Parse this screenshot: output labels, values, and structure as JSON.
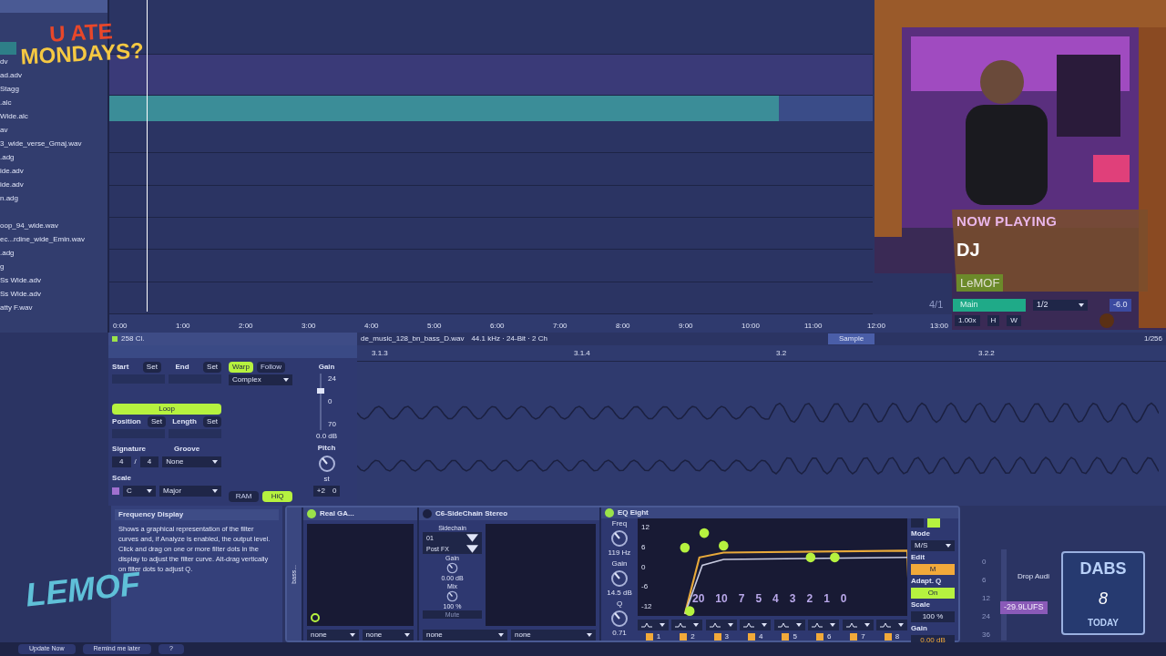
{
  "logo": {
    "line1": "U ATE",
    "line2": "MONDAYS?"
  },
  "browser": {
    "files": [
      "dv",
      "ad.adv",
      "Stagg",
      ".alc",
      "Wide.alc",
      "av",
      "3_wide_verse_Gmaj.wav",
      ".adg",
      "ide.adv",
      "ide.adv",
      "n.adg",
      "oop_94_wide.wav",
      "ec...rdine_wide_Emin.wav",
      ".adg",
      "g",
      "Ss Wide.adv",
      "Ss Wide.adv",
      "atty F.wav"
    ]
  },
  "arrangement": {
    "ruler": [
      "0:00",
      "1:00",
      "2:00",
      "3:00",
      "4:00",
      "5:00",
      "6:00",
      "7:00",
      "8:00",
      "9:00",
      "10:00",
      "11:00",
      "12:00",
      "13:00"
    ],
    "meter": "4/1"
  },
  "stream": {
    "heading": "NOW PLAYING",
    "dj": "DJ",
    "artist": "LeMOF",
    "main_clip": "Main",
    "quantize": "1/2",
    "volume": "-6.0",
    "tempo_scale": "1.00x",
    "buttons": [
      "H",
      "W"
    ]
  },
  "clip": {
    "name": "258 Cl.",
    "start": "Start",
    "end": "End",
    "set_buttons": [
      "Set",
      "Set",
      "Set",
      "Set"
    ],
    "gain_fader": {
      "level": 0.7
    },
    "loop": {
      "label": "Loop",
      "on": true
    },
    "position": "Position",
    "length": "Length",
    "signature": "Signature",
    "sig_num": "4",
    "sig_sep": "/",
    "sig_den": "4",
    "groove": "Groove",
    "groove_value": "None",
    "scale": "Scale",
    "scale_root": "C",
    "scale_mode": "Major",
    "warp": {
      "label": "Warp",
      "on": true
    },
    "follow": {
      "label": "Follow",
      "on": false
    },
    "warp_mode": "Complex",
    "ram": {
      "label": "RAM",
      "on": false
    },
    "hiq": {
      "label": "HiQ",
      "on": true
    },
    "gain": "Gain",
    "gain_ticks": [
      "24",
      "0",
      "70"
    ],
    "gain_value": "0.0 dB",
    "pitch": "Pitch",
    "pitch_unit": "st",
    "pitch_values": [
      "+2",
      "0"
    ]
  },
  "sample": {
    "file": "de_music_128_bn_bass_D.wav",
    "format": "44.1 kHz · 24-Bit · 2 Ch",
    "tab": "Sample",
    "zoom": "1/256",
    "markers": [
      "3.1.3",
      "3.1.4",
      "3.2",
      "3.2.2"
    ]
  },
  "info": {
    "title": "Frequency Display",
    "body": "Shows a graphical representation of the filter curves and, if Analyze is enabled, the output level. Click and drag on one or more filter dots in the display to adjust the filter curve. Alt-drag vertically on filter dots to adjust Q."
  },
  "rack": {
    "label": "bass..."
  },
  "devices": [
    {
      "kind": "generic",
      "name": "Real GA...",
      "on": true,
      "routes": [
        "none",
        "none"
      ]
    },
    {
      "kind": "sidechain",
      "name": "C6-SideChain Stereo",
      "on": false,
      "sidechain": "Sidechain",
      "source": "01",
      "tap": "Post FX",
      "gain": "Gain",
      "gain_value": "0.00 dB",
      "mix": "Mix",
      "mix_value": "100 %",
      "mute": "Mute",
      "routes": [
        "none",
        "none"
      ]
    },
    {
      "kind": "eq",
      "name": "EQ Eight",
      "on": true,
      "freq": "Freq",
      "freq_value": "119 Hz",
      "gain": "Gain",
      "gain_value": "14.5 dB",
      "q": "Q",
      "q_value": "0.71",
      "y_ticks": [
        "12",
        "6",
        "0",
        "-6",
        "-12"
      ],
      "overlay_scale": [
        "20",
        "10",
        "7",
        "5",
        "4",
        "3",
        "2",
        "1",
        "0"
      ],
      "bands": [
        {
          "label": "1",
          "on": true
        },
        {
          "label": "2",
          "on": true
        },
        {
          "label": "3",
          "on": true
        },
        {
          "label": "4",
          "on": true
        },
        {
          "label": "5",
          "on": true
        },
        {
          "label": "6",
          "on": true
        },
        {
          "label": "7",
          "on": true
        },
        {
          "label": "8",
          "on": true
        }
      ],
      "mode": "Mode",
      "mode_value": "M/S",
      "edit": "Edit",
      "edit_value": "M",
      "adapt": {
        "label": "Adapt. Q",
        "value": "On",
        "on": true
      },
      "scale": "Scale",
      "scale_value": "100 %",
      "out_gain": "Gain",
      "out_gain_value": "0.00 dB"
    }
  ],
  "meter": {
    "scale": [
      "0",
      "6",
      "12",
      "24",
      "36"
    ],
    "drop_hint": "Drop Audi",
    "loudness": "-29.9LUFS"
  },
  "badge": {
    "top": "DABS",
    "number": "8",
    "bottom": "TODAY"
  },
  "graffiti": "LEMOF",
  "update_bar": {
    "buttons": [
      "Update Now",
      "Remind me later",
      "?"
    ]
  }
}
